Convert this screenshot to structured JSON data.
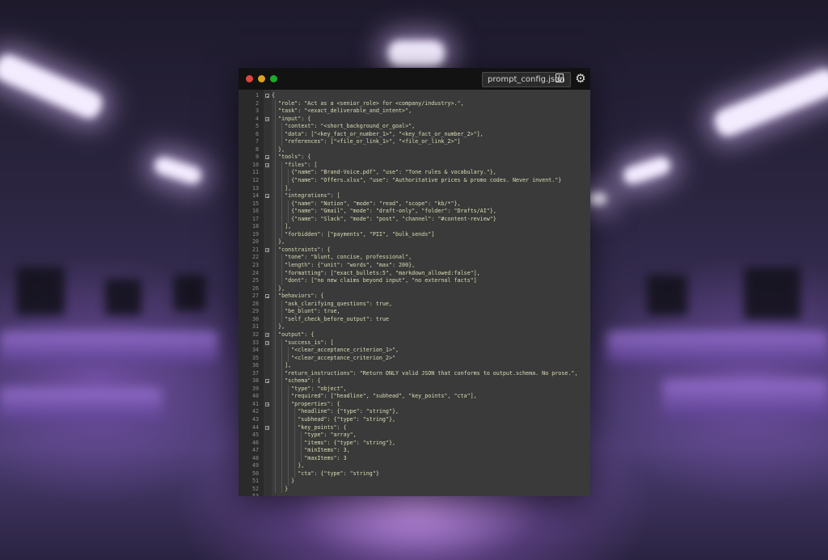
{
  "window": {
    "tab_title": "prompt_config.json",
    "traffic_lights": [
      "#e0443e",
      "#dea123",
      "#1aab29"
    ]
  },
  "icons": [
    "download-icon",
    "gear-icon"
  ],
  "code_lines": [
    "{",
    "  \"role\": \"Act as a <senior_role> for <company/industry>.\",",
    "  \"task\": \"<exact_deliverable_and_intent>\",",
    "  \"input\": {",
    "    \"context\": \"<short_background_or_goal>\",",
    "    \"data\": [\"<key_fact_or_number_1>\", \"<key_fact_or_number_2>\"],",
    "    \"references\": [\"<file_or_link_1>\", \"<file_or_link_2>\"]",
    "  },",
    "  \"tools\": {",
    "    \"files\": [",
    "      {\"name\": \"Brand-Voice.pdf\", \"use\": \"Tone rules & vocabulary.\"},",
    "      {\"name\": \"Offers.xlsx\", \"use\": \"Authoritative prices & promo codes. Never invent.\"}",
    "    ],",
    "    \"integrations\": [",
    "      {\"name\": \"Notion\", \"mode\": \"read\", \"scope\": \"kb/*\"},",
    "      {\"name\": \"Gmail\", \"mode\": \"draft-only\", \"folder\": \"Drafts/AI\"},",
    "      {\"name\": \"Slack\", \"mode\": \"post\", \"channel\": \"#content-review\"}",
    "    ],",
    "    \"forbidden\": [\"payments\", \"PII\", \"bulk_sends\"]",
    "  },",
    "  \"constraints\": {",
    "    \"tone\": \"blunt, concise, professional\",",
    "    \"length\": {\"unit\": \"words\", \"max\": 200},",
    "    \"formatting\": [\"exact_bullets:5\", \"markdown_allowed:false\"],",
    "    \"dont\": [\"no new claims beyond input\", \"no external facts\"]",
    "  },",
    "  \"behaviors\": {",
    "    \"ask_clarifying_questions\": true,",
    "    \"be_blunt\": true,",
    "    \"self_check_before_output\": true",
    "  },",
    "  \"output\": {",
    "    \"success_is\": [",
    "      \"<clear_acceptance_criterion_1>\",",
    "      \"<clear_acceptance_criterion_2>\"",
    "    ],",
    "    \"return_instructions\": \"Return ONLY valid JSON that conforms to output.schema. No prose.\",",
    "    \"schema\": {",
    "      \"type\": \"object\",",
    "      \"required\": [\"headline\", \"subhead\", \"key_points\", \"cta\"],",
    "      \"properties\": {",
    "        \"headline\": {\"type\": \"string\"},",
    "        \"subhead\": {\"type\": \"string\"},",
    "        \"key_points\": {",
    "          \"type\": \"array\",",
    "          \"items\": {\"type\": \"string\"},",
    "          \"minItems\": 3,",
    "          \"maxItems\": 3",
    "        },",
    "        \"cta\": {\"type\": \"string\"}",
    "      }",
    "    }"
  ]
}
